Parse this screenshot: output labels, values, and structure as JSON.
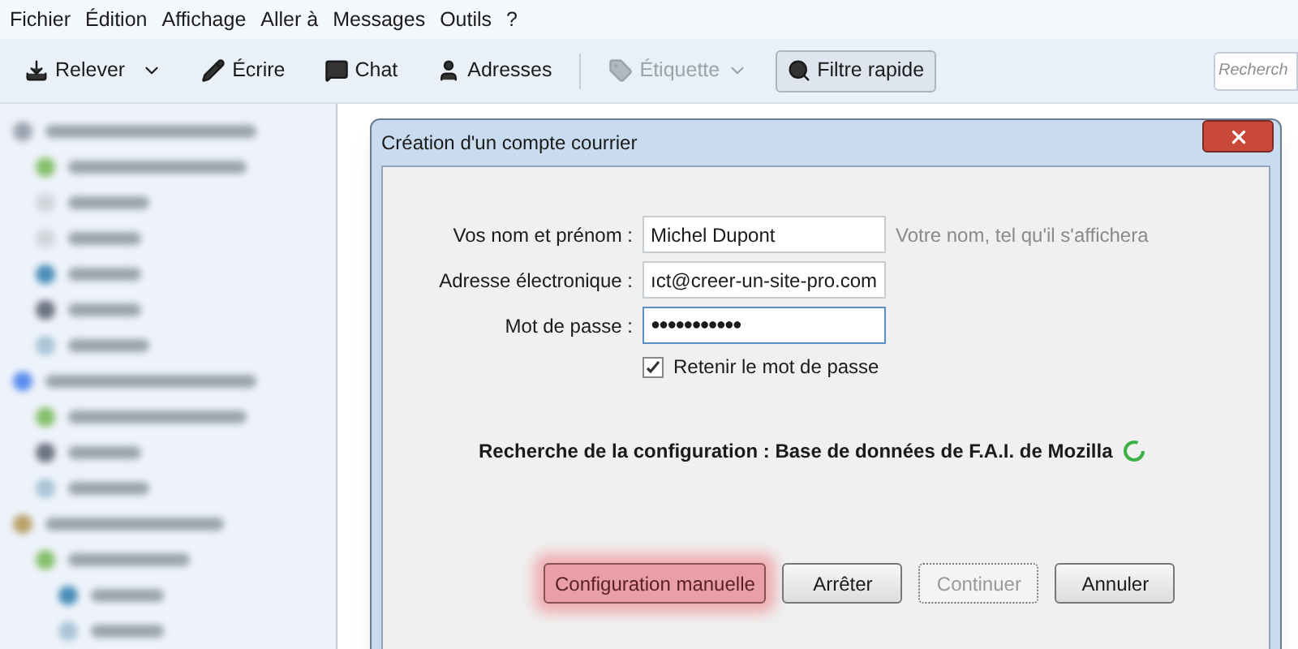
{
  "menu": [
    "Fichier",
    "Édition",
    "Affichage",
    "Aller à",
    "Messages",
    "Outils",
    "?"
  ],
  "toolbar": {
    "buttons": [
      {
        "kind": "get",
        "label": "Relever",
        "disabled": false,
        "on": false
      },
      {
        "kind": "write",
        "label": "Écrire",
        "disabled": false,
        "on": false
      },
      {
        "kind": "chat",
        "label": "Chat",
        "disabled": false,
        "on": false
      },
      {
        "kind": "contacts",
        "label": "Adresses",
        "disabled": false,
        "on": false
      },
      {
        "kind": "tag",
        "label": "Étiquette",
        "disabled": true,
        "on": false
      },
      {
        "kind": "filter",
        "label": "Filtre rapide",
        "disabled": false,
        "on": true
      }
    ],
    "search": {
      "placeholder": "Recherch"
    }
  },
  "dialog": {
    "title": "Création d'un compte courrier",
    "fields": [
      {
        "label": "Vos nom et prénom :",
        "value": "Michel Dupont",
        "hint": "Votre nom, tel qu'il s'affichera",
        "kind": "text"
      },
      {
        "label": "Adresse électronique :",
        "value": "ıct@creer-un-site-pro.com",
        "kind": "text"
      },
      {
        "label": "Mot de passe :",
        "value": "●●●●●●●●●●●",
        "kind": "password"
      }
    ],
    "remember": {
      "label": "Retenir le mot de passe",
      "checked": true
    },
    "status": "Recherche de la configuration : Base de données de F.A.I. de Mozilla",
    "buttons": [
      {
        "label": "Configuration manuelle",
        "highlighted": true,
        "disabled": false
      },
      {
        "label": "Arrêter",
        "highlighted": false,
        "disabled": false
      },
      {
        "label": "Continuer",
        "highlighted": false,
        "disabled": true
      },
      {
        "label": "Annuler",
        "highlighted": false,
        "disabled": false
      }
    ]
  }
}
